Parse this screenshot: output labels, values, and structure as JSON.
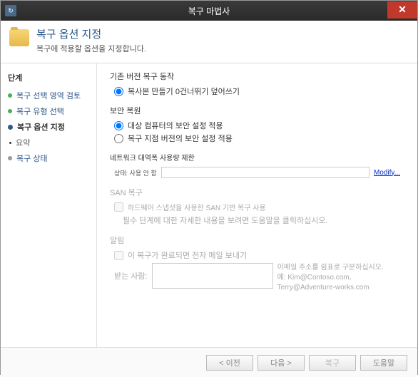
{
  "titlebar": {
    "title": "복구 마법사",
    "close": "✕"
  },
  "header": {
    "title": "복구 옵션 지정",
    "subtitle": "복구에 적용할 옵션을 지정합니다."
  },
  "sidebar": {
    "heading": "단계",
    "items": [
      {
        "label": "복구 선택 영역 검토"
      },
      {
        "label": "복구 유형 선택"
      },
      {
        "label": "복구 옵션 지정"
      },
      {
        "label": "요약"
      },
      {
        "label": "복구 상태"
      }
    ]
  },
  "main": {
    "existing_version": {
      "title": "기존 버전 복구 동작",
      "option1": "복사본 만들기 0건너뛰기 덮어쓰기"
    },
    "security": {
      "title": "보안 복원",
      "option1": "대상 컴퓨터의 보안 설정 적용",
      "option2": "복구 지점 버전의 보안 설정 적용"
    },
    "network": {
      "title": "네트워크 대역폭 사용량 제한",
      "status_label": "상태: 사용 안 함",
      "modify": "Modify..."
    },
    "san": {
      "title": "SAN 복구",
      "checkbox": "하드웨어 스냅샷을 사용한 SAN 기반 복구 사용",
      "help": "필수 단계에 대한 자세한 내용을 보려면 도움말을 클릭하십시오."
    },
    "notify": {
      "title": "알림",
      "checkbox": "이 복구가 완료되면 전자 메일 보내기",
      "recipient_label": "받는 사람:",
      "hint1": "이메일 주소를 쉼표로 구분하십시오.",
      "hint2": "예: Kim@Contoso.com, Terry@Adventure-works.com"
    }
  },
  "footer": {
    "back": "< 이전",
    "next": "다음 >",
    "recover": "복구",
    "cancel": "도움말"
  }
}
